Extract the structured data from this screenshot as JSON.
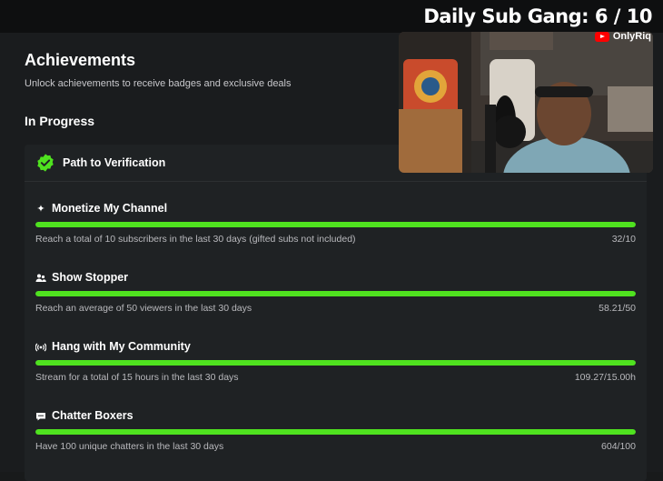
{
  "overlay": {
    "title": "Daily Sub Gang:  6 / 10",
    "channel": "OnlyRiq"
  },
  "page": {
    "title": "Achievements",
    "subtitle": "Unlock achievements to receive badges and exclusive deals",
    "section": "In Progress"
  },
  "card": {
    "title": "Path to Verification",
    "achievements": [
      {
        "icon": "sparkle-icon",
        "title": "Monetize My Channel",
        "description": "Reach a total of 10 subscribers in the last 30 days (gifted subs not included)",
        "value": "32/10",
        "progress": 1.0
      },
      {
        "icon": "people-icon",
        "title": "Show Stopper",
        "description": "Reach an average of 50 viewers in the last 30 days",
        "value": "58.21/50",
        "progress": 1.0
      },
      {
        "icon": "broadcast-icon",
        "title": "Hang with My Community",
        "description": "Stream for a total of 15 hours in the last 30 days",
        "value": "109.27/15.00h",
        "progress": 1.0
      },
      {
        "icon": "chat-icon",
        "title": "Chatter Boxers",
        "description": "Have 100 unique chatters in the last 30 days",
        "value": "604/100",
        "progress": 1.0
      }
    ]
  },
  "colors": {
    "progress": "#4fe21f",
    "verified": "#4fe21f"
  }
}
